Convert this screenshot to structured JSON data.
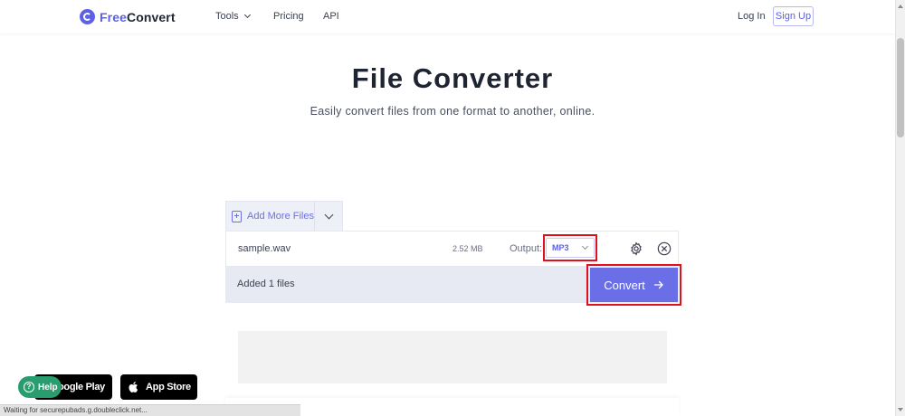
{
  "header": {
    "logo_free": "Free",
    "logo_convert": "Convert",
    "nav": {
      "tools": "Tools",
      "pricing": "Pricing",
      "api": "API"
    },
    "login": "Log In",
    "signup": "Sign Up"
  },
  "hero": {
    "title": "File Converter",
    "subtitle": "Easily convert files from one format to another, online."
  },
  "converter": {
    "add_more": "Add More Files",
    "file": {
      "name": "sample.wav",
      "size": "2.52 MB",
      "output_label": "Output:",
      "output_value": "MP3"
    },
    "added_text": "Added 1 files",
    "convert_label": "Convert"
  },
  "badges": {
    "google_play": "Google Play",
    "app_store": "App Store",
    "help": "Help"
  },
  "status_bar": "Waiting for securepubads.g.doubleclick.net...",
  "colors": {
    "brand": "#5c61e8",
    "convert_button": "#6a6fe8",
    "highlight": "#e0101e",
    "help": "#2a9d6f"
  }
}
